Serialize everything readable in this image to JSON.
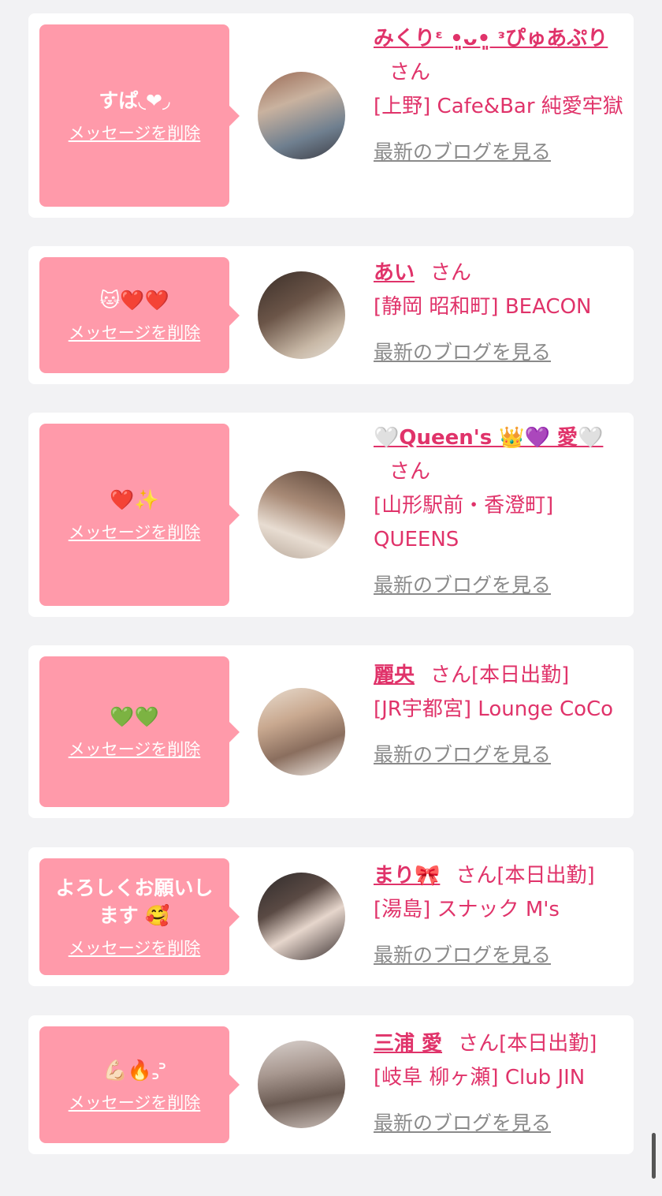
{
  "delete_label": "メッセージを削除",
  "blog_label": "最新のブログを見る",
  "colors": {
    "bubble": "#ff9aaa",
    "accent": "#e0336a",
    "muted_link": "#8a8a8a",
    "page_bg": "#f2f2f4"
  },
  "messages": [
    {
      "message": "すぱ◟❤︎◞",
      "name": "みくりᵋ •͈ᴗ•͈ ᵌぴゅあぷり",
      "honorific": "さん",
      "status": "",
      "shop": "[上野] Cafe&Bar 純愛牢獄",
      "avatar_icon": "photo-avatar"
    },
    {
      "message": "🐱❤️❤️",
      "name": "あい",
      "honorific": "さん",
      "status": "",
      "shop": "[静岡 昭和町] BEACON",
      "avatar_icon": "photo-avatar"
    },
    {
      "message": "❤️✨",
      "name": "🤍Queen's 👑💜 愛🤍",
      "honorific": "さん",
      "status": "",
      "shop": "[山形駅前・香澄町] QUEENS",
      "avatar_icon": "photo-avatar"
    },
    {
      "message": "💚💚",
      "name": "麗央",
      "honorific": "さん",
      "status": "[本日出勤]",
      "shop": "[JR宇都宮] Lounge CoCo",
      "avatar_icon": "photo-avatar"
    },
    {
      "message": "よろしくお願いします 🥰",
      "name": "まり🎀",
      "honorific": "さん",
      "status": "[本日出勤]",
      "shop": "[湯島] スナック M's",
      "avatar_icon": "photo-avatar"
    },
    {
      "message": "💪🏻🔥꜆꜄",
      "name": "三浦 愛",
      "honorific": "さん",
      "status": "[本日出勤]",
      "shop": "[岐阜 柳ヶ瀬] Club JIN",
      "avatar_icon": "photo-avatar"
    }
  ]
}
